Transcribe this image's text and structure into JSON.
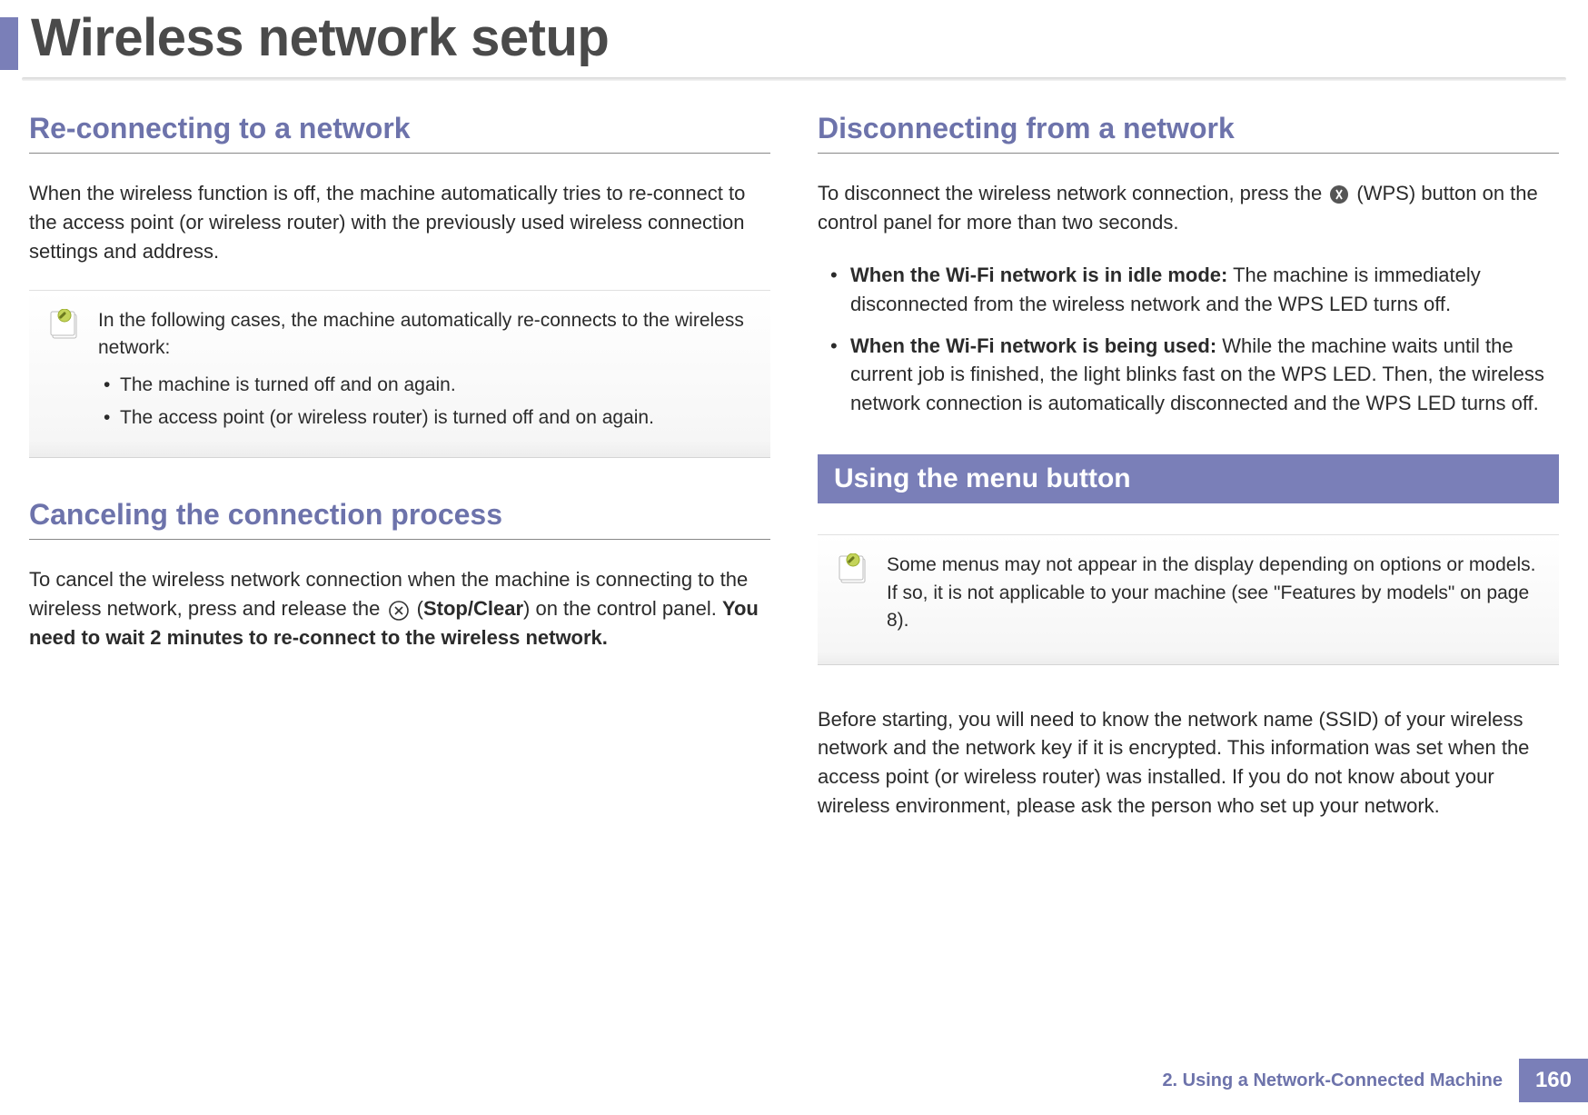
{
  "page_title": "Wireless network setup",
  "left": {
    "sec1": {
      "heading": "Re-connecting to a network",
      "para": "When the wireless function is off, the machine automatically tries to re-connect to the access point (or wireless router) with the previously used wireless connection settings and address.",
      "note_intro": "In the following cases, the machine automatically re-connects to the wireless network:",
      "note_items": [
        "The machine is turned off and on again.",
        "The access point (or wireless router) is turned off and on again."
      ]
    },
    "sec2": {
      "heading": "Canceling the connection process",
      "para_pre": "To cancel the wireless network connection when the machine is connecting to the wireless network, press and release the ",
      "stop_label": "Stop/Clear",
      "para_mid": ") on the control panel. ",
      "para_bold": "You need to wait 2 minutes to re-connect to the wireless network."
    }
  },
  "right": {
    "sec1": {
      "heading": "Disconnecting from a network",
      "para_pre": "To disconnect the wireless network connection, press the ",
      "para_post": " (WPS) button on the control panel for more than two seconds.",
      "items": [
        {
          "bold": "When the Wi-Fi network is in idle mode:",
          "rest": " The machine is immediately disconnected from the wireless network and the WPS LED turns off."
        },
        {
          "bold": "When the Wi-Fi network is being used:",
          "rest": " While the machine waits until the current job is finished, the light blinks fast on the WPS LED. Then, the wireless network connection is automatically disconnected and the WPS LED turns off."
        }
      ]
    },
    "sec2": {
      "heading": "Using the menu button",
      "note": "Some menus may not appear in the display depending on options or models. If so, it is not applicable to your machine (see \"Features by models\" on page 8).",
      "para": "Before starting, you will need to know the network name (SSID) of your wireless network and the network key if it is encrypted. This information was set when the access point (or wireless router) was installed. If you do not know about your wireless environment, please ask the person who set up your network."
    }
  },
  "footer": {
    "chapter": "2.  Using a Network-Connected Machine",
    "page": "160"
  }
}
